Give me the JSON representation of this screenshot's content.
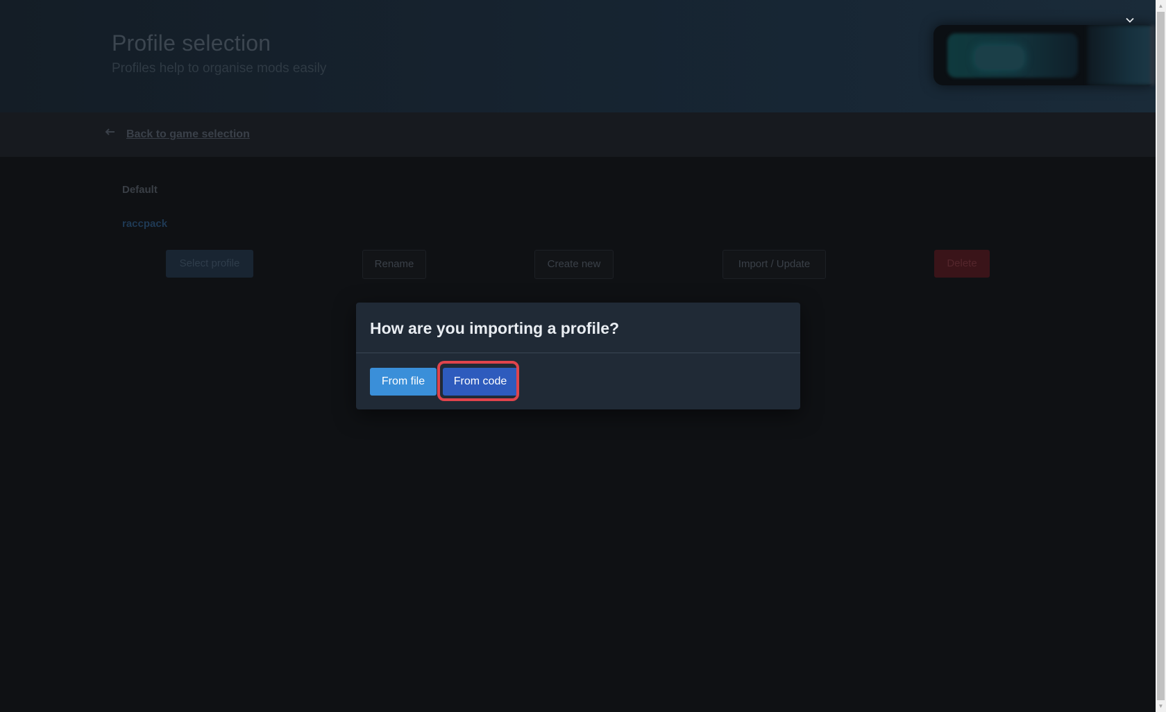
{
  "header": {
    "title": "Profile selection",
    "subtitle": "Profiles help to organise mods easily",
    "collapse_icon": "chevron-down-icon"
  },
  "nav": {
    "back_icon": "arrow-left-icon",
    "back_label": "Back to game selection"
  },
  "profiles": {
    "items": [
      "Default",
      "raccpack"
    ],
    "selected": "raccpack"
  },
  "actions": {
    "select_label": "Select profile",
    "rename_label": "Rename",
    "create_label": "Create new",
    "import_label": "Import / Update",
    "delete_label": "Delete"
  },
  "modal": {
    "title": "How are you importing a profile?",
    "from_file_label": "From file",
    "from_code_label": "From code"
  },
  "colors": {
    "accent_file": "#3a8fd9",
    "accent_code": "#2e5bbd",
    "focus_ring": "#e0444c",
    "modal_bg": "#202a36",
    "page_bg": "#0f1114"
  }
}
